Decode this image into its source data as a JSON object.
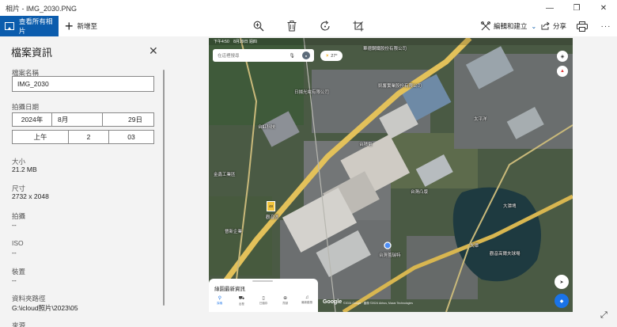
{
  "window": {
    "title": "相片 - IMG_2030.PNG",
    "minimize": "—",
    "maximize": "❐",
    "close": "✕"
  },
  "toolbar": {
    "view_all": "查看所有相片",
    "add_to": "新增至",
    "edit_create": "編輯和建立",
    "share": "分享",
    "icons": [
      "zoom-in-icon",
      "delete-icon",
      "rotate-icon",
      "crop-icon",
      "print-icon",
      "more-icon"
    ]
  },
  "info": {
    "title": "檔案資訊",
    "filename_label": "檔案名稱",
    "filename": "IMG_2030",
    "date_label": "拍攝日期",
    "year": "2024年",
    "month": "8月",
    "day": "29日",
    "ampm": "上午",
    "hour": "2",
    "minute": "03",
    "size_label": "大小",
    "size": "21.2 MB",
    "dimensions_label": "尺寸",
    "dimensions": "2732 x 2048",
    "camera_label": "拍攝",
    "camera": "--",
    "iso_label": "ISO",
    "iso": "--",
    "device_label": "裝置",
    "device": "--",
    "folder_label": "資料夾路徑",
    "folder": "G:\\icloud照片\\2023\\05",
    "source_label": "來源"
  },
  "map": {
    "status_time": "下午4:50",
    "status_date": "8月29日 週四",
    "search_placeholder": "在這裡搜尋",
    "weather": "27°",
    "sheet_title": "綠園最新資訊",
    "nav": [
      "探索",
      "出發",
      "已儲存",
      "貢獻",
      "最新動態"
    ],
    "google": "Google",
    "copyright": "©2024 Google · 圖像 ©2024 Airbus, Maxar Technologies",
    "highway": "48",
    "labels": [
      "華德鋼鐵股份有限公司",
      "日揚光電有限公司",
      "台虹科技",
      "台積電",
      "台灣凸版",
      "觀音區",
      "大潭",
      "凱馨實業股份有限公司",
      "太平洋",
      "金鑫工業區",
      "大潭埤",
      "觀音高爾夫球場",
      "台灣蓋瑞特",
      "晉新企業"
    ]
  }
}
